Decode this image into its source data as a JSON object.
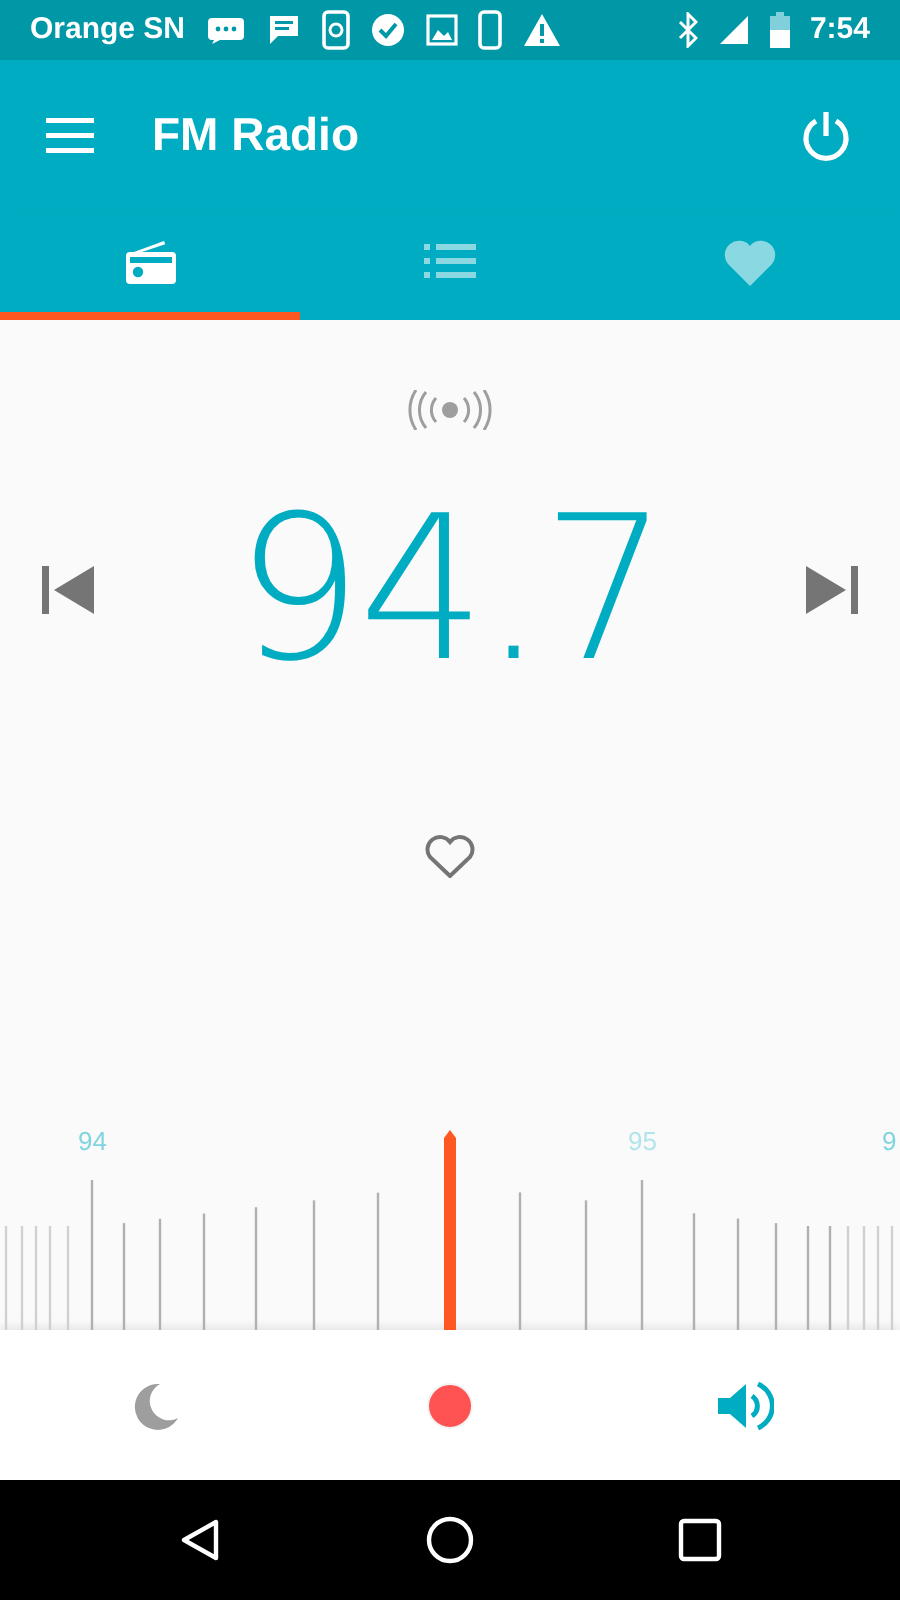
{
  "status_bar": {
    "carrier": "Orange SN",
    "time": "7:54"
  },
  "app_bar": {
    "title": "FM Radio"
  },
  "tabs": [
    {
      "kind": "radio",
      "selected": true
    },
    {
      "kind": "list",
      "selected": false
    },
    {
      "kind": "favorites",
      "selected": false
    }
  ],
  "station": {
    "frequency": "94.7",
    "favorite": false
  },
  "tuning_scale": {
    "labels": [
      "94",
      "95",
      "9"
    ]
  },
  "bottom_bar": {
    "recording": false
  }
}
